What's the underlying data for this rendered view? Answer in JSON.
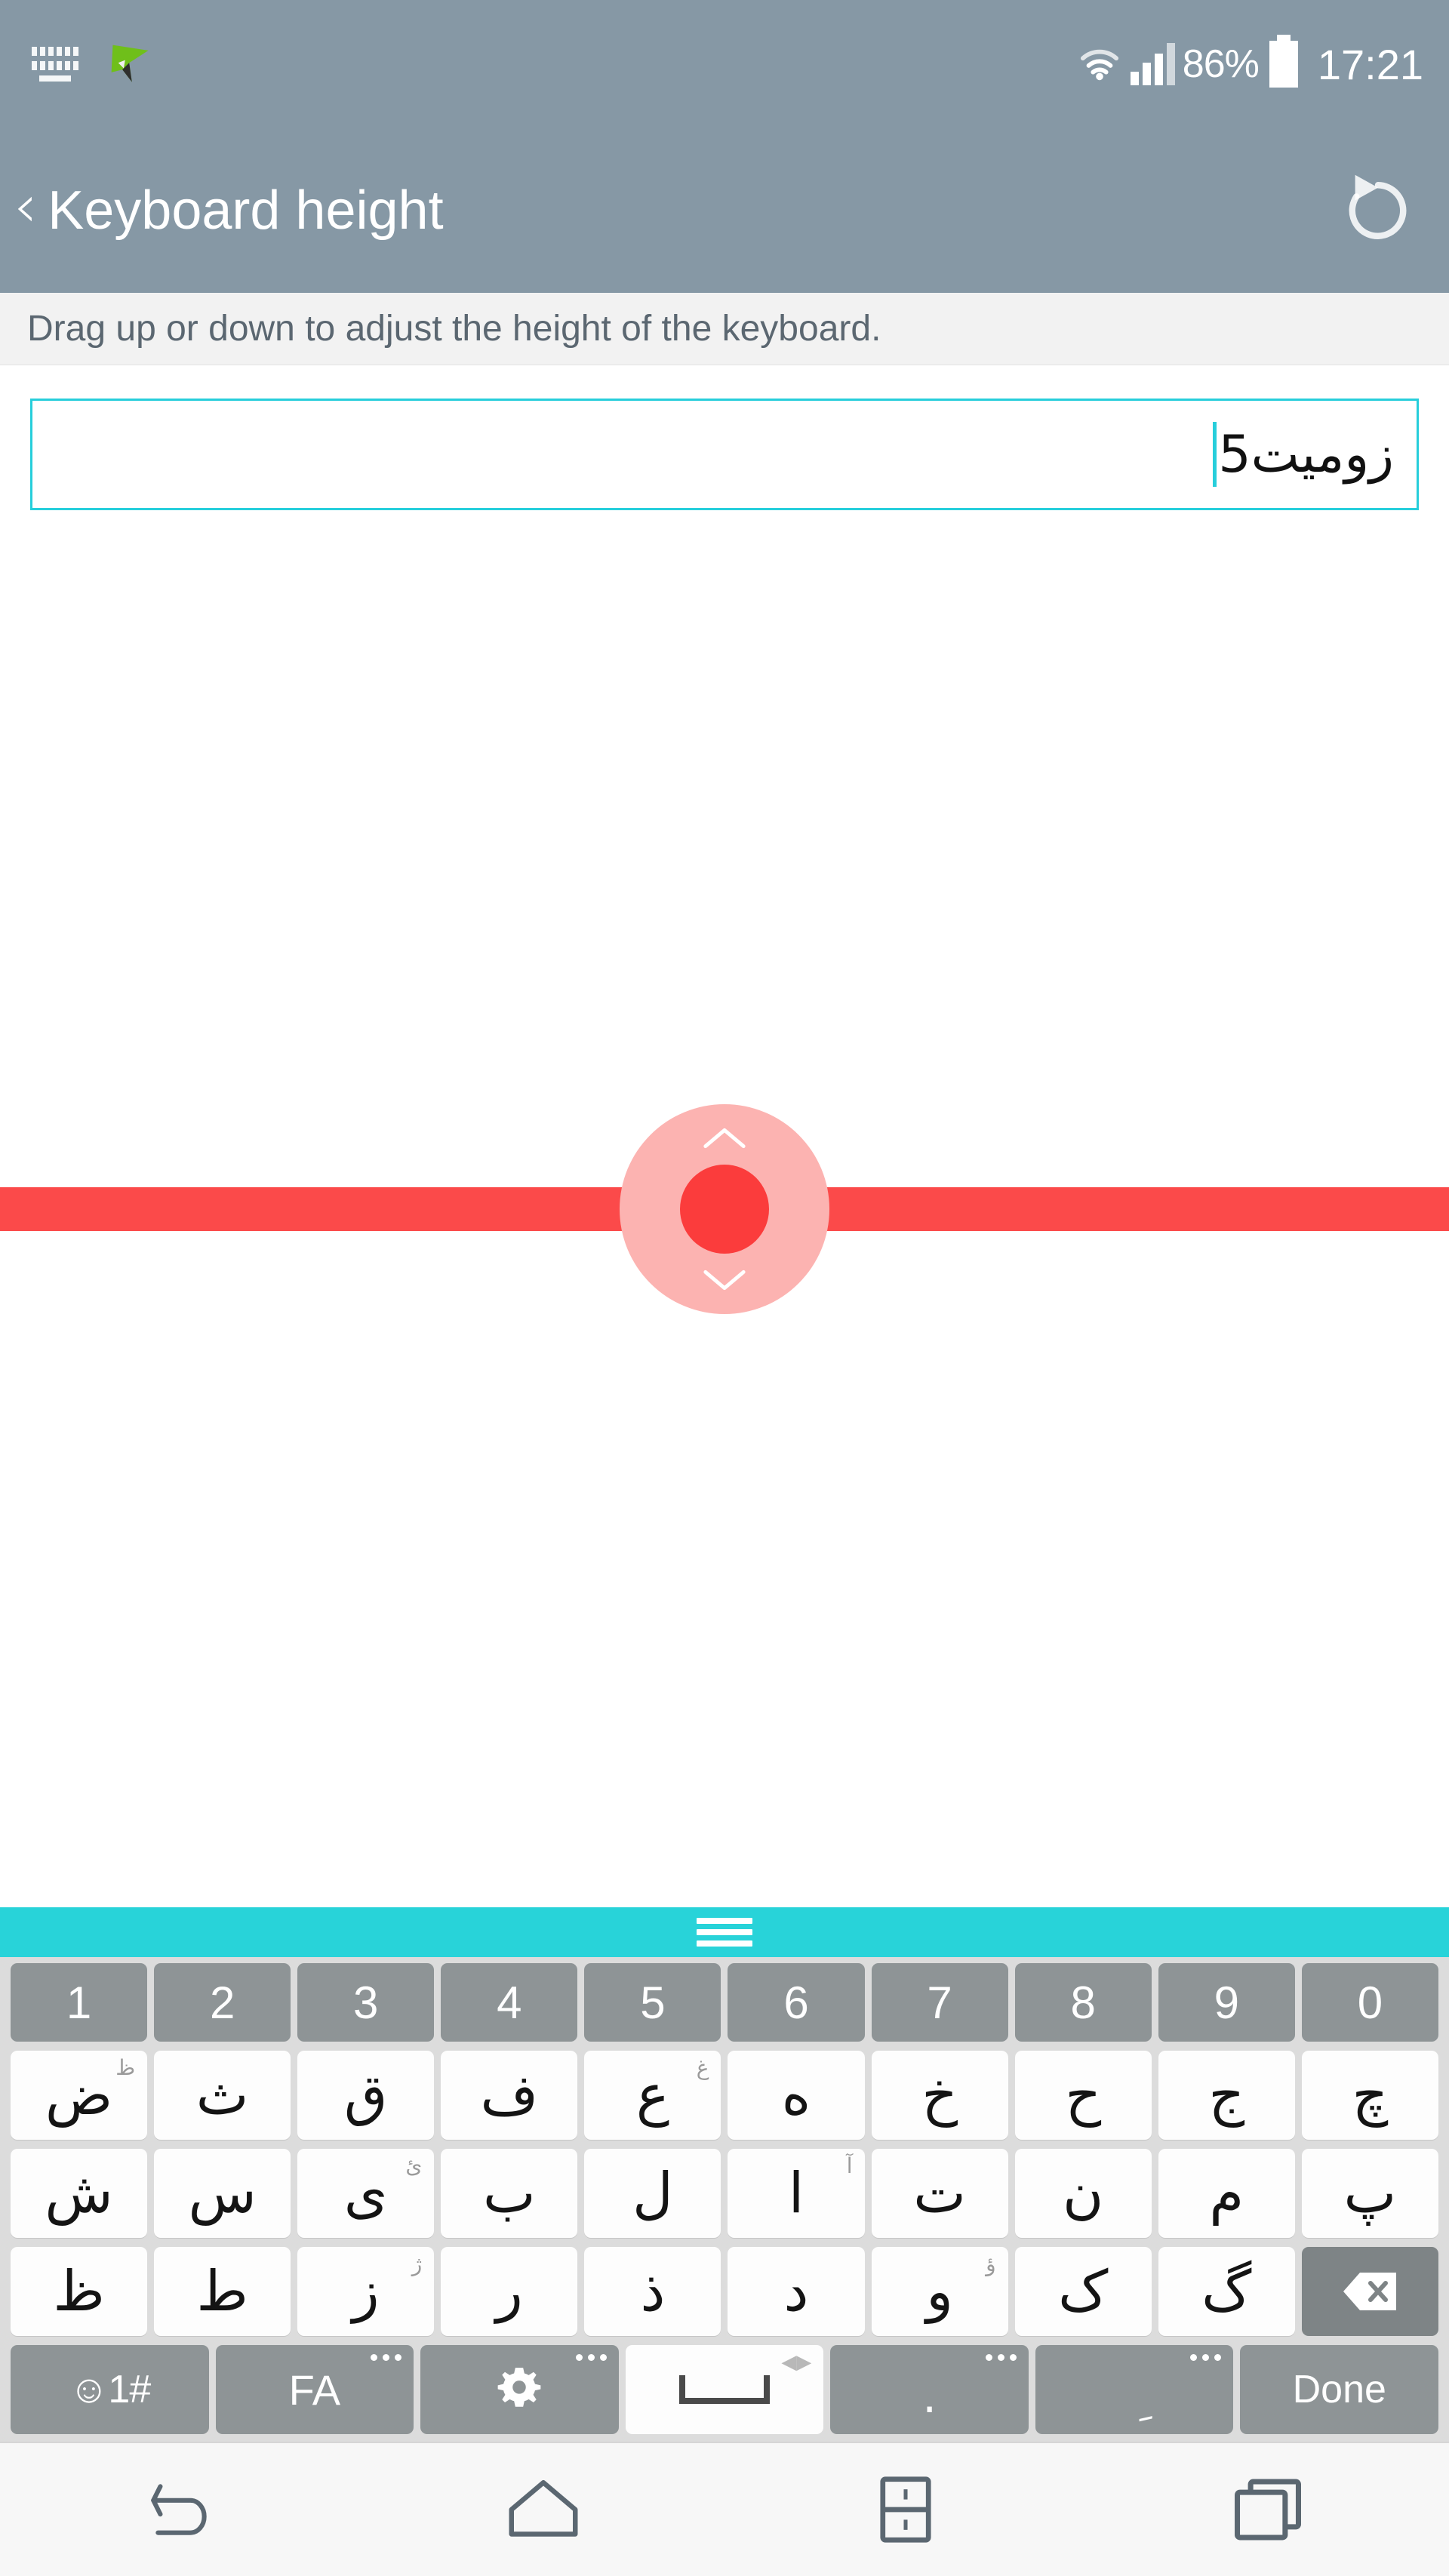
{
  "status_bar": {
    "left_icons": [
      "keyboard-icon",
      "green-arrow-icon"
    ],
    "wifi_icon": "wifi-icon",
    "signal_icon": "signal-bars-icon",
    "battery_percent": "86%",
    "battery_icon": "battery-icon",
    "clock": "17:21"
  },
  "header": {
    "back_label": "‹",
    "title": "Keyboard height",
    "reset_icon": "reset-icon"
  },
  "instruction": {
    "text": "Drag up or down to adjust the height of the keyboard."
  },
  "text_field": {
    "value": "زومیت5",
    "placeholder": ""
  },
  "drag_control": {
    "up_icon": "chevron-up-icon",
    "down_icon": "chevron-down-icon",
    "handle_icon": "drag-handle-icon",
    "line_color": "#fb4a4a",
    "halo_color": "#fcb3b1",
    "core_color": "#fb3c3c"
  },
  "keyboard": {
    "grip_bar_color": "#28d3d9",
    "grip_icon": "keyboard-resize-grip-icon",
    "background": "#dcdcdc",
    "number_key_color": "#8e9496",
    "letter_key_color": "#fdfdfd",
    "rows": [
      {
        "name": "number-row",
        "type": "num",
        "keys": [
          {
            "label": "1"
          },
          {
            "label": "2"
          },
          {
            "label": "3"
          },
          {
            "label": "4"
          },
          {
            "label": "5"
          },
          {
            "label": "6"
          },
          {
            "label": "7"
          },
          {
            "label": "8"
          },
          {
            "label": "9"
          },
          {
            "label": "0"
          }
        ]
      },
      {
        "name": "letter-row-1",
        "type": "letter",
        "keys": [
          {
            "label": "ض",
            "hint": "ظ"
          },
          {
            "label": "ث",
            "hint": ""
          },
          {
            "label": "ق",
            "hint": ""
          },
          {
            "label": "ف",
            "hint": ""
          },
          {
            "label": "ع",
            "hint": "غ"
          },
          {
            "label": "ه",
            "hint": ""
          },
          {
            "label": "خ",
            "hint": ""
          },
          {
            "label": "ح",
            "hint": ""
          },
          {
            "label": "ج",
            "hint": ""
          },
          {
            "label": "چ",
            "hint": ""
          }
        ]
      },
      {
        "name": "letter-row-2",
        "type": "letter",
        "keys": [
          {
            "label": "ش",
            "hint": ""
          },
          {
            "label": "س",
            "hint": ""
          },
          {
            "label": "ی",
            "hint": "ئ"
          },
          {
            "label": "ب",
            "hint": ""
          },
          {
            "label": "ل",
            "hint": ""
          },
          {
            "label": "ا",
            "hint": "آ"
          },
          {
            "label": "ت",
            "hint": ""
          },
          {
            "label": "ن",
            "hint": ""
          },
          {
            "label": "م",
            "hint": ""
          },
          {
            "label": "پ",
            "hint": ""
          }
        ]
      },
      {
        "name": "letter-row-3",
        "type": "letter",
        "keys": [
          {
            "label": "ظ",
            "hint": ""
          },
          {
            "label": "ط",
            "hint": ""
          },
          {
            "label": "ز",
            "hint": "ژ"
          },
          {
            "label": "ر",
            "hint": ""
          },
          {
            "label": "ذ",
            "hint": ""
          },
          {
            "label": "د",
            "hint": ""
          },
          {
            "label": "و",
            "hint": "ؤ"
          },
          {
            "label": "ک",
            "hint": ""
          },
          {
            "label": "گ",
            "hint": ""
          }
        ],
        "backspace": {
          "name": "backspace-key",
          "icon": "backspace-icon"
        }
      }
    ],
    "bottom_row": {
      "name": "function-row",
      "symbol_key": {
        "label": "☺1#",
        "name": "emoji-symbols-key"
      },
      "language_key": {
        "label": "FA",
        "name": "language-key"
      },
      "settings_key": {
        "label": "",
        "name": "settings-key",
        "icon": "gear-icon"
      },
      "space_key": {
        "label": "",
        "name": "space-key",
        "icon": "space-icon"
      },
      "period_key": {
        "label": ".",
        "name": "period-key"
      },
      "diacritic_key": {
        "label": "ِ",
        "name": "diacritic-key"
      },
      "done_key": {
        "label": "Done",
        "name": "done-key"
      }
    }
  },
  "nav_bar": {
    "back_icon": "nav-back-icon",
    "home_icon": "nav-home-icon",
    "dual_window_icon": "nav-dual-window-icon",
    "recents_icon": "nav-recents-icon"
  }
}
